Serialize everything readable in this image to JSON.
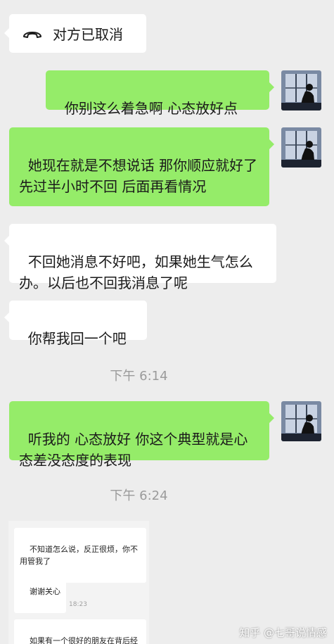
{
  "call_status": {
    "text": "对方已取消",
    "icon": "hangup-phone-icon"
  },
  "messages": [
    {
      "side": "right",
      "text": "你别这么着急啊 心态放好点"
    },
    {
      "side": "right",
      "text": "她现在就是不想说话 那你顺应就好了 先过半小时不回 后面再看情况"
    },
    {
      "side": "left",
      "text": "不回她消息不好吧，如果她生气怎么办。以后也不回我消息了呢"
    },
    {
      "side": "left",
      "text": "你帮我回一个吧"
    },
    {
      "side": "right",
      "text": "听我的 心态放好 你这个典型就是心态差没态度的表现"
    }
  ],
  "timestamps": [
    "下午 6:14",
    "下午 6:24"
  ],
  "inner_screenshot": {
    "messages": [
      "不知道怎么说，反正很烦，你不用管我了",
      "谢谢关心",
      "如果有一个很好的朋友在背后经常说你坏话你回怎么办"
    ],
    "timestamp": "18:23"
  },
  "watermark": "知乎 @七哥说情感",
  "colors": {
    "background": "#ededed",
    "sent_bubble": "#95ec69",
    "received_bubble": "#ffffff"
  }
}
